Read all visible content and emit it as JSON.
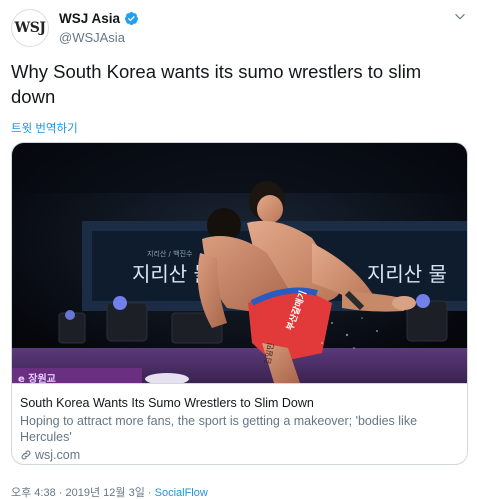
{
  "author": {
    "avatar_text": "WSJ",
    "display_name": "WSJ Asia",
    "handle": "@WSJAsia"
  },
  "tweet": {
    "text": "Why South Korea wants its sumo wrestlers to slim down",
    "translate_label": "트윗 번역하기"
  },
  "card": {
    "image_sign_left": "지리산 물",
    "image_sign_right": "지리산 물",
    "image_sign_small": "지리산 / 백진수",
    "image_shorts_text": "부산갈매기",
    "image_leg_text": "김일민",
    "image_banner_text": "e 장원교",
    "title": "South Korea Wants Its Sumo Wrestlers to Slim Down",
    "description": "Hoping to attract more fans, the sport is getting a makeover; 'bodies like Hercules'",
    "domain": "wsj.com"
  },
  "meta": {
    "time": "오후 4:38",
    "separator": "·",
    "date": "2019년 12월 3일",
    "source": "SocialFlow"
  },
  "colors": {
    "link": "#1b95e0",
    "verified": "#1da1f2",
    "secondary_text": "#657786"
  },
  "icons": {
    "verified": "verified-badge-icon",
    "caret": "chevron-down-icon",
    "link": "link-icon"
  }
}
